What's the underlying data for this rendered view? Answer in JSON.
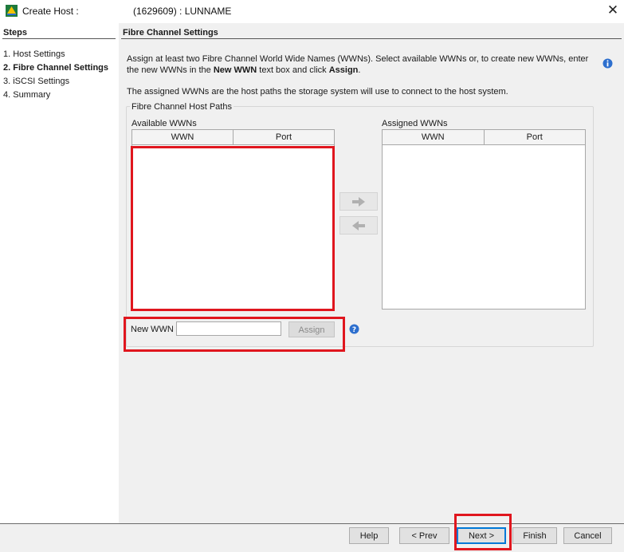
{
  "window": {
    "title": "Create Host :",
    "subtitle": "(1629609) : LUNNAME",
    "close_glyph": "✕",
    "icon": "app-logo-icon"
  },
  "steps": {
    "heading": "Steps",
    "items": [
      {
        "label": "1. Host Settings",
        "active": false
      },
      {
        "label": "2. Fibre Channel Settings",
        "active": true
      },
      {
        "label": "3. iSCSI Settings",
        "active": false
      },
      {
        "label": "4. Summary",
        "active": false
      }
    ]
  },
  "main": {
    "heading": "Fibre Channel Settings",
    "intro_line1": "Assign at least two Fibre Channel World Wide Names (WWNs). Select available WWNs or, to create new WWNs, enter",
    "intro_line2_pre": "the new WWNs in the ",
    "intro_line2_bold1": "New WWN",
    "intro_line2_mid": " text box and click ",
    "intro_line2_bold2": "Assign",
    "intro_line2_end": ".",
    "intro_paths": "The assigned WWNs are the host paths the storage system will use to connect to the host system.",
    "group_title": "Fibre Channel Host Paths",
    "available": {
      "label": "Available WWNs",
      "columns": [
        "WWN",
        "Port"
      ]
    },
    "assigned": {
      "label": "Assigned WWNs",
      "columns": [
        "WWN",
        "Port"
      ]
    },
    "new_wwn": {
      "label": "New WWN",
      "value": "",
      "placeholder": "",
      "assign_label": "Assign"
    }
  },
  "footer": {
    "help": "Help",
    "prev": "< Prev",
    "next": "Next >",
    "finish": "Finish",
    "cancel": "Cancel"
  },
  "colors": {
    "highlight": "#e0161e",
    "panel": "#f0f0f0",
    "focus": "#0078d7"
  }
}
